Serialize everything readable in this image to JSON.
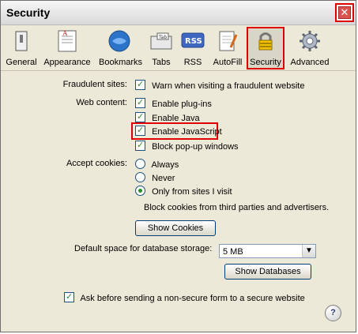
{
  "window": {
    "title": "Security",
    "close_symbol": "✕"
  },
  "toolbar": {
    "items": [
      {
        "label": "General",
        "icon": "general-icon"
      },
      {
        "label": "Appearance",
        "icon": "appearance-icon"
      },
      {
        "label": "Bookmarks",
        "icon": "bookmarks-icon"
      },
      {
        "label": "Tabs",
        "icon": "tabs-icon",
        "icon_text": "Tab"
      },
      {
        "label": "RSS",
        "icon": "rss-icon",
        "icon_text": "RSS"
      },
      {
        "label": "AutoFill",
        "icon": "autofill-icon"
      },
      {
        "label": "Security",
        "icon": "security-icon",
        "selected": true
      },
      {
        "label": "Advanced",
        "icon": "advanced-icon"
      }
    ]
  },
  "sections": {
    "fraudulent": {
      "label": "Fraudulent sites:",
      "option": "Warn when visiting a fraudulent website"
    },
    "web_content": {
      "label": "Web content:",
      "options": [
        "Enable plug-ins",
        "Enable Java",
        "Enable JavaScript",
        "Block pop-up windows"
      ]
    },
    "cookies": {
      "label": "Accept cookies:",
      "options": [
        "Always",
        "Never",
        "Only from sites I visit"
      ],
      "selected_index": 2,
      "note": "Block cookies from third parties and advertisers.",
      "button": "Show Cookies"
    },
    "database": {
      "label": "Default space for database storage:",
      "value": "5 MB",
      "button": "Show Databases"
    },
    "nonsecure": {
      "option": "Ask before sending a non-secure form to a secure website"
    }
  },
  "help": {
    "symbol": "?"
  },
  "colors": {
    "highlight": "#e00000",
    "check": "#2a8f2a"
  }
}
